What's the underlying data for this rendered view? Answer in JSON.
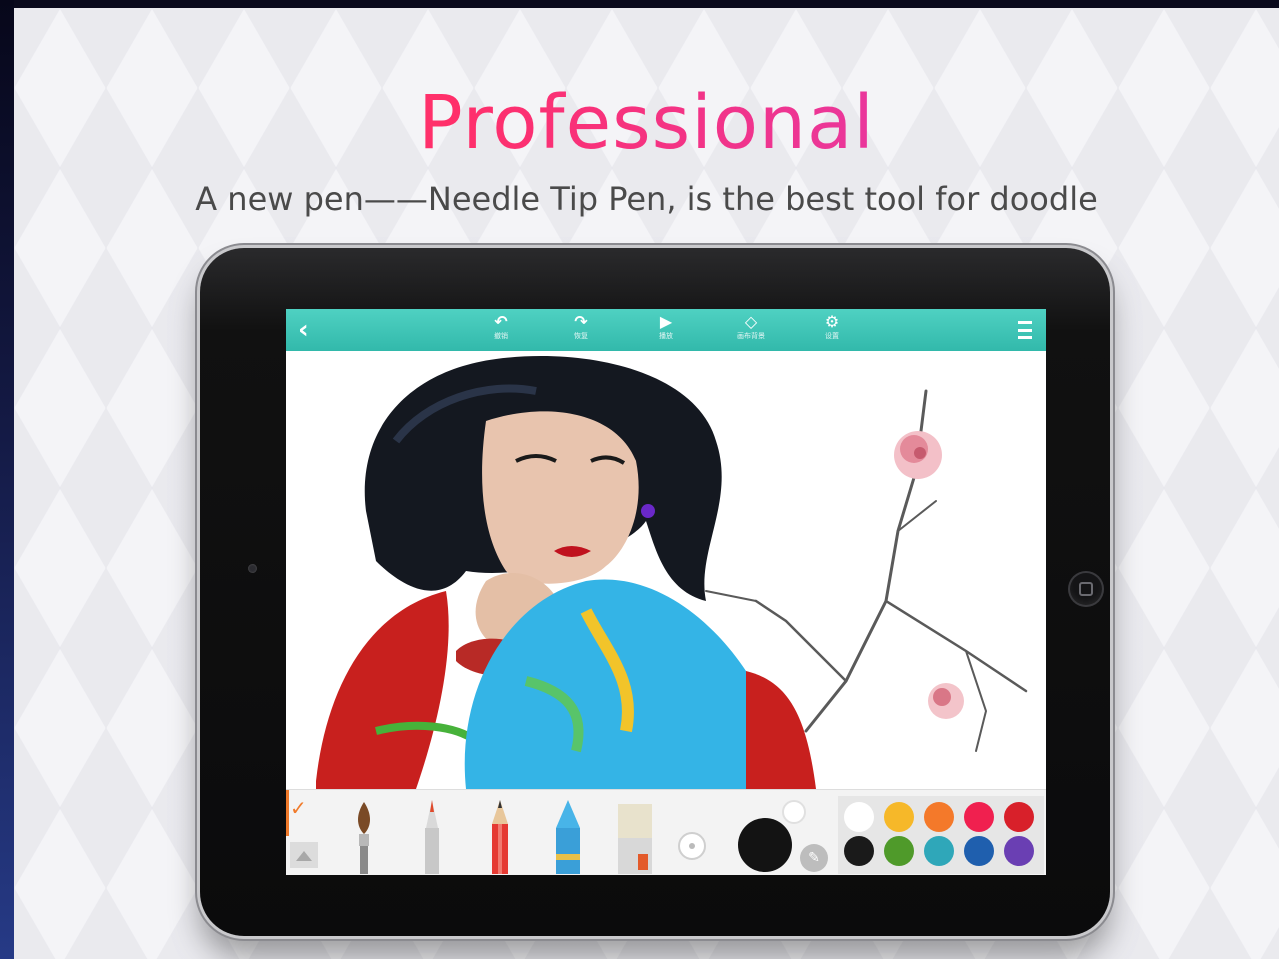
{
  "promo": {
    "headline": "Professional",
    "subtitle": "A new pen——Needle Tip Pen, is the best tool for doodle"
  },
  "colors": {
    "headline_gradient_start": "#ff3a78",
    "headline_gradient_end": "#c446d2",
    "toolbar_teal": "#3cc3b4",
    "active_tool_orange": "#f07a2a"
  },
  "app": {
    "toolbar": {
      "back_icon": "chevron-left-icon",
      "back_glyph": "‹",
      "menu_icon": "menu-icon",
      "actions": [
        {
          "icon": "undo-icon",
          "glyph": "↶",
          "caption": "撤销"
        },
        {
          "icon": "redo-icon",
          "glyph": "↷",
          "caption": "恢复"
        },
        {
          "icon": "play-icon",
          "glyph": "▶",
          "caption": "播放"
        },
        {
          "icon": "layers-icon",
          "glyph": "◇",
          "caption": "画布背景"
        },
        {
          "icon": "settings-icon",
          "glyph": "⚙",
          "caption": "设置"
        }
      ]
    },
    "brush_tools": [
      {
        "name": "watercolor-brush",
        "icon": "paintbrush-icon"
      },
      {
        "name": "needle-tip-pen",
        "icon": "pen-icon"
      },
      {
        "name": "pencil",
        "icon": "pencil-icon"
      },
      {
        "name": "crayon",
        "icon": "crayon-icon"
      },
      {
        "name": "eraser",
        "icon": "eraser-icon"
      }
    ],
    "active_tool_glyph": "✓",
    "picker_glyph": "✎",
    "current_color": "#131313",
    "palette": [
      "#ffffff",
      "#f6b829",
      "#f4792a",
      "#f0204f",
      "#d8202a",
      "#1a1a1a",
      "#4f9a2a",
      "#2fa7b9",
      "#1f5fae",
      "#6a3fb3"
    ]
  }
}
